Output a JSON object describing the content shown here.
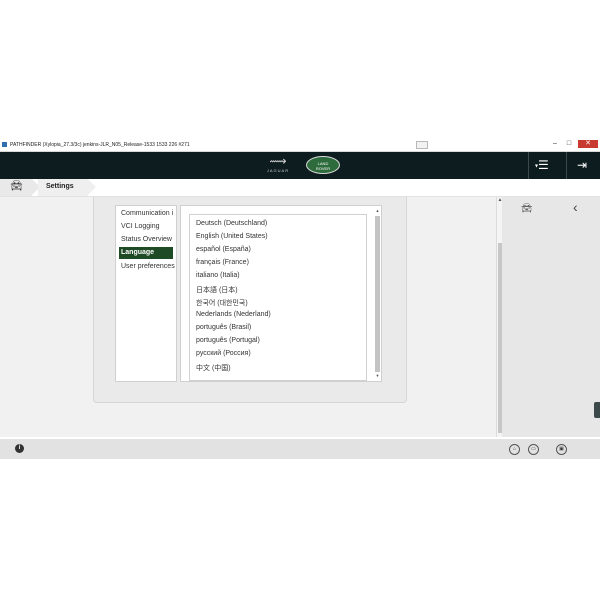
{
  "window": {
    "title": "PATHFINDER (Xylopia_27.3/3c) jenkins-JLR_N05_Release-1533 1533 226 #271",
    "minimize": "–",
    "maximize": "□",
    "close": "✕"
  },
  "appbar": {
    "brand_jaguar": "JAGUAR",
    "brand_landrover_line1": "LAND",
    "brand_landrover_line2": "ROVER",
    "menu_icon": "hamburger-menu-icon",
    "exit_icon": "exit-icon"
  },
  "breadcrumb": {
    "home_icon": "car-icon",
    "current": "Settings"
  },
  "settings_menu": {
    "items": [
      {
        "label": "Communication i"
      },
      {
        "label": "VCI Logging"
      },
      {
        "label": "Status Overview"
      },
      {
        "label": "Language",
        "active": true
      },
      {
        "label": "User preferences"
      }
    ]
  },
  "languages": [
    "Deutsch (Deutschland)",
    "English (United States)",
    "español (España)",
    "français (France)",
    "italiano (Italia)",
    "日本語 (日本)",
    "한국어 (대한민국)",
    "Nederlands (Nederland)",
    "português (Brasil)",
    "português (Portugal)",
    "русский (Россия)",
    "中文 (中国)"
  ],
  "colors": {
    "appbar": "#0d1c1e",
    "active_item": "#1e4a26",
    "landrover": "#2d6b3d"
  }
}
